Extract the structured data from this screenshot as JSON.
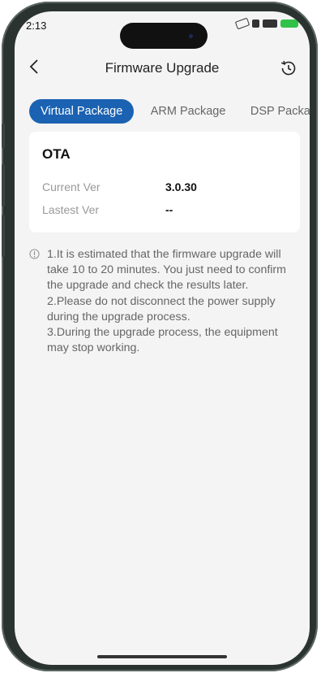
{
  "status": {
    "time": "2:13"
  },
  "header": {
    "title": "Firmware Upgrade",
    "back_icon": "chevron-left-icon",
    "history_icon": "history-icon"
  },
  "tabs": [
    {
      "label": "Virtual Package",
      "active": true
    },
    {
      "label": "ARM Package",
      "active": false
    },
    {
      "label": "DSP Package",
      "active": false
    }
  ],
  "card": {
    "title": "OTA",
    "rows": [
      {
        "label": "Current Ver",
        "value": "3.0.30"
      },
      {
        "label": "Lastest Ver",
        "value": "--"
      }
    ]
  },
  "note": {
    "lines": [
      "1.It is estimated that the firmware upgrade will",
      "take 10 to 20 minutes. You just need to confirm",
      "the upgrade and check the results later.",
      "2.Please do not disconnect the power supply",
      "during the upgrade process.",
      "3.During the upgrade process, the equipment",
      "may stop working."
    ]
  },
  "colors": {
    "accent": "#1b62b2",
    "background": "#f4f4f4"
  }
}
